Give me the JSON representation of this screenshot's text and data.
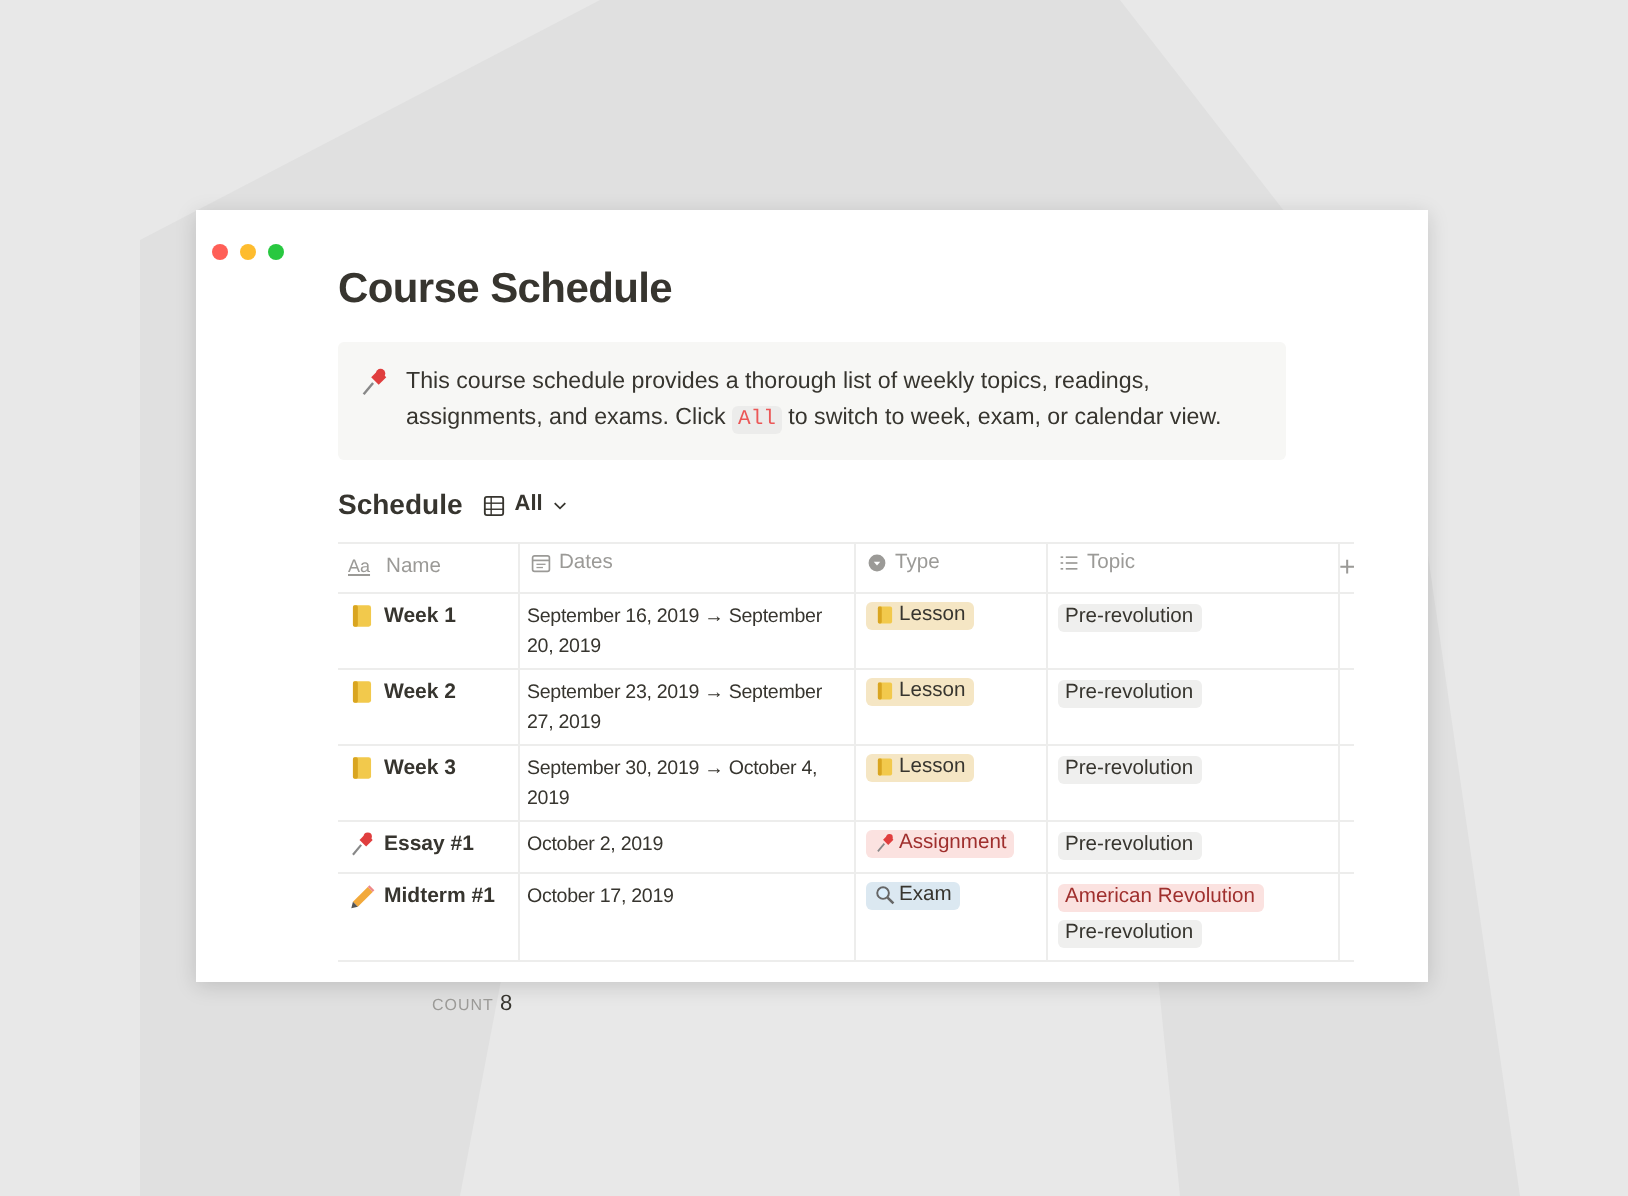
{
  "window": {
    "title": "Course Schedule"
  },
  "callout": {
    "text_before": "This course schedule provides a thorough list of weekly topics, readings, assignments, and exams. Click ",
    "code": "All",
    "text_after": " to switch to week, exam, or calendar view."
  },
  "view": {
    "title": "Schedule",
    "selector": "All"
  },
  "table": {
    "columns": [
      {
        "label": "Name",
        "glyph": "Aa"
      },
      {
        "label": "Dates"
      },
      {
        "label": "Type"
      },
      {
        "label": "Topic"
      }
    ],
    "add_column": "+",
    "rows": [
      {
        "kind": "lesson",
        "name": "Week 1",
        "dates": "September 16, 2019 → September 20, 2019",
        "type": {
          "label": "Lesson",
          "color": "#f5e6c4"
        },
        "topics": [
          {
            "label": "Pre-revolution",
            "color": "#efefee"
          }
        ]
      },
      {
        "kind": "lesson",
        "name": "Week 2",
        "dates": "September 23, 2019 → September 27, 2019",
        "type": {
          "label": "Lesson",
          "color": "#f5e6c4"
        },
        "topics": [
          {
            "label": "Pre-revolution",
            "color": "#efefee"
          }
        ]
      },
      {
        "kind": "lesson",
        "name": "Week 3",
        "dates": "September 30, 2019 → October 4, 2019",
        "type": {
          "label": "Lesson",
          "color": "#f5e6c4"
        },
        "topics": [
          {
            "label": "Pre-revolution",
            "color": "#efefee"
          }
        ]
      },
      {
        "kind": "assignment",
        "name": "Essay #1",
        "dates": "October 2, 2019",
        "type": {
          "label": "Assignment",
          "color": "#fbe2e0"
        },
        "topics": [
          {
            "label": "Pre-revolution",
            "color": "#efefee"
          }
        ]
      },
      {
        "kind": "exam",
        "name": "Midterm #1",
        "dates": "October 17, 2019",
        "type": {
          "label": "Exam",
          "color": "#dbe8f1"
        },
        "topics": [
          {
            "label": "American Revolution",
            "color": "#fbe2e0"
          },
          {
            "label": "Pre-revolution",
            "color": "#efefee"
          }
        ]
      }
    ],
    "count_label": "COUNT",
    "count": "8"
  }
}
